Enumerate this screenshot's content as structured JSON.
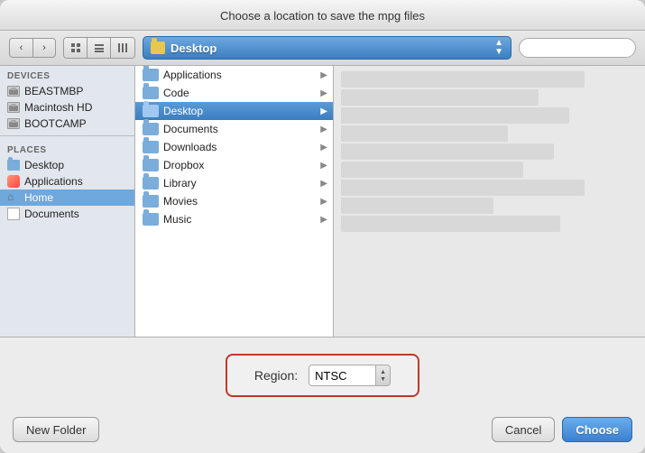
{
  "dialog": {
    "title": "Choose a location to save the mpg files"
  },
  "toolbar": {
    "location": "Desktop",
    "search_placeholder": ""
  },
  "sidebar": {
    "devices_header": "DEVICES",
    "places_header": "PLACES",
    "devices": [
      {
        "label": "BEASTMBP",
        "icon": "drive"
      },
      {
        "label": "Macintosh HD",
        "icon": "drive"
      },
      {
        "label": "BOOTCAMP",
        "icon": "drive"
      }
    ],
    "places": [
      {
        "label": "Desktop",
        "icon": "folder",
        "selected": false
      },
      {
        "label": "Applications",
        "icon": "app"
      },
      {
        "label": "Home",
        "icon": "home"
      },
      {
        "label": "Documents",
        "icon": "doc"
      }
    ]
  },
  "files": {
    "items": [
      {
        "label": "Applications",
        "hasArrow": true
      },
      {
        "label": "Code",
        "hasArrow": true
      },
      {
        "label": "Desktop",
        "hasArrow": true,
        "selected": true
      },
      {
        "label": "Documents",
        "hasArrow": true
      },
      {
        "label": "Downloads",
        "hasArrow": true
      },
      {
        "label": "Dropbox",
        "hasArrow": true
      },
      {
        "label": "Library",
        "hasArrow": true
      },
      {
        "label": "Movies",
        "hasArrow": true
      },
      {
        "label": "Music",
        "hasArrow": true
      }
    ]
  },
  "region": {
    "label": "Region:",
    "value": "NTSC"
  },
  "buttons": {
    "new_folder": "New Folder",
    "cancel": "Cancel",
    "choose": "Choose"
  }
}
